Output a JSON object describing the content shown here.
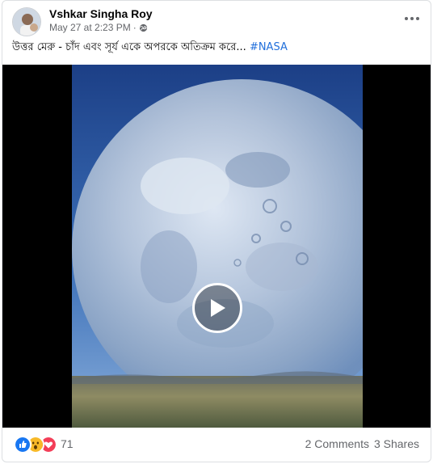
{
  "post": {
    "author": "Vshkar Singha Roy",
    "timestamp": "May 27 at 2:23 PM",
    "audience_icon": "globe-icon",
    "caption_text": "উত্তর মেরু - চাঁদ এবং সূর্য একে অপরকে অতিক্রম করে...",
    "hashtag": "#NASA"
  },
  "video": {
    "play_icon": "play-icon"
  },
  "footer": {
    "reactions": [
      "like",
      "wow",
      "love"
    ],
    "reaction_count": "71",
    "comments": "2 Comments",
    "shares": "3 Shares"
  },
  "colors": {
    "like": "#1877f2",
    "wow": "#f7b928",
    "love": "#f33e58",
    "link": "#216fdb",
    "secondary_text": "#65676b"
  }
}
